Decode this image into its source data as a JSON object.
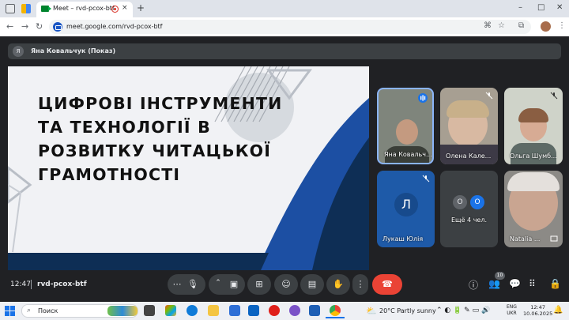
{
  "browser": {
    "tab_title": "Meet – rvd-pcox-btf",
    "tab_close": "×",
    "new_tab": "+",
    "url": "meet.google.com/rvd-pcox-btf",
    "window_controls": [
      "–",
      "□",
      "✕"
    ]
  },
  "meet": {
    "presenter": {
      "initial": "Я",
      "label": "Яна Ковальчук (Показ)"
    },
    "slide": {
      "title_lines": [
        "ЦИФРОВІ ІНСТРУМЕНТИ",
        "ТА ТЕХНОЛОГІЇ В",
        "РОЗВИТКУ ЧИТАЦЬКОЇ",
        "ГРАМОТНОСТІ"
      ]
    },
    "participants": [
      {
        "name": "Яна Ковальч...",
        "speaking": true
      },
      {
        "name": "Олена Кале...",
        "muted": true
      },
      {
        "name": "Ольга Шумб...",
        "muted": true
      },
      {
        "name": "Лукаш Юлія",
        "initial": "Л",
        "muted": true
      },
      {
        "name": "Ещё 4 чел.",
        "avatars": [
          "О",
          "О"
        ]
      },
      {
        "name": "Natalia ..."
      }
    ],
    "bottom": {
      "time": "12:47",
      "meeting_code": "rvd-pcox-btf",
      "people_count": "10"
    }
  },
  "taskbar": {
    "search_placeholder": "Поиск",
    "weather": "20°C  Partly sunny",
    "language": [
      "ENG",
      "UKR"
    ],
    "time": "12:47",
    "date": "10.06.2025"
  },
  "colors": {
    "meet_bg": "#202124",
    "control_bg": "#3c4043",
    "hangup": "#ea4335",
    "slide_navy": "#0e2e55",
    "slide_blue": "#1c4fa3",
    "participant_blue": "#1e5aa8"
  }
}
